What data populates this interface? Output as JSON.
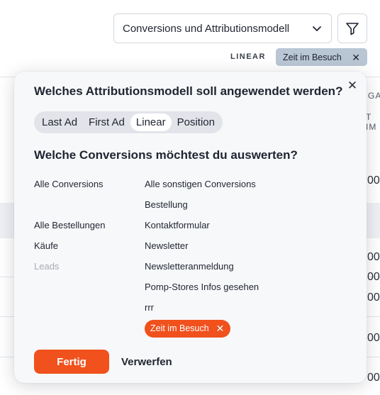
{
  "background": {
    "edge_labels": [
      "GA",
      "T IM"
    ],
    "edge_numbers": [
      "00",
      "00",
      "00",
      "00",
      "00",
      "00"
    ]
  },
  "toolbar": {
    "select_value": "Conversions und Attributionsmodell",
    "active_model_label": "LINEAR",
    "active_filter_chip": "Zeit im Besuch"
  },
  "popover": {
    "question_model": "Welches Attributionsmodell soll angewendet werden?",
    "models": [
      "Last Ad",
      "First Ad",
      "Linear",
      "Position"
    ],
    "selected_model": "Linear",
    "question_conversions": "Welche Conversions möchtest du auswerten?",
    "groups": [
      {
        "label": "Alle Conversions",
        "enabled": true
      },
      {
        "label": "Alle Bestellungen",
        "enabled": true
      },
      {
        "label": "Käufe",
        "enabled": true
      },
      {
        "label": "Leads",
        "enabled": false
      }
    ],
    "conversions": [
      "Alle sonstigen Conversions",
      "Bestellung",
      "Kontaktformular",
      "Newsletter",
      "Newsletteranmeldung",
      "Pomp-Stores Infos gesehen",
      "rrr"
    ],
    "selected_conversion": "Zeit im Besuch",
    "done_label": "Fertig",
    "discard_label": "Verwerfen"
  },
  "colors": {
    "accent": "#f0511d",
    "chip_bg": "#b9c6d4",
    "popover_bg": "#f7f8fa"
  }
}
